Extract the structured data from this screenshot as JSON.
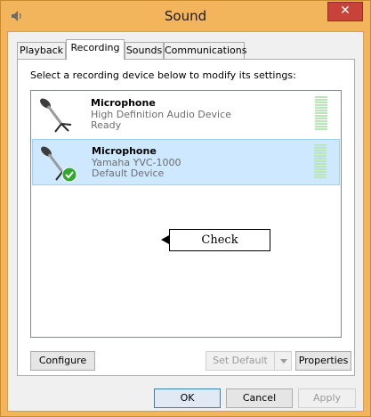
{
  "window": {
    "title": "Sound",
    "close_label": "✕"
  },
  "tabs": [
    {
      "label": "Playback"
    },
    {
      "label": "Recording"
    },
    {
      "label": "Sounds"
    },
    {
      "label": "Communications"
    }
  ],
  "panel": {
    "instruction": "Select a recording device below to modify its settings:"
  },
  "devices": [
    {
      "name": "Microphone",
      "description": "High Definition Audio Device",
      "status": "Ready",
      "selected": false,
      "default": false
    },
    {
      "name": "Microphone",
      "description": "Yamaha YVC-1000",
      "status": "Default Device",
      "selected": true,
      "default": true
    }
  ],
  "annotation": {
    "text": "Check"
  },
  "buttons": {
    "configure": "Configure",
    "set_default": "Set Default",
    "properties": "Properties",
    "ok": "OK",
    "cancel": "Cancel",
    "apply": "Apply"
  },
  "icons": {
    "title_icon": "speaker-icon",
    "device_icon": "microphone-icon",
    "default_badge": "checkmark-icon"
  },
  "colors": {
    "title_bar": "#f3b55b",
    "close_button": "#c7433a",
    "selection": "#cde8ff",
    "default_badge": "#2fa82f"
  }
}
